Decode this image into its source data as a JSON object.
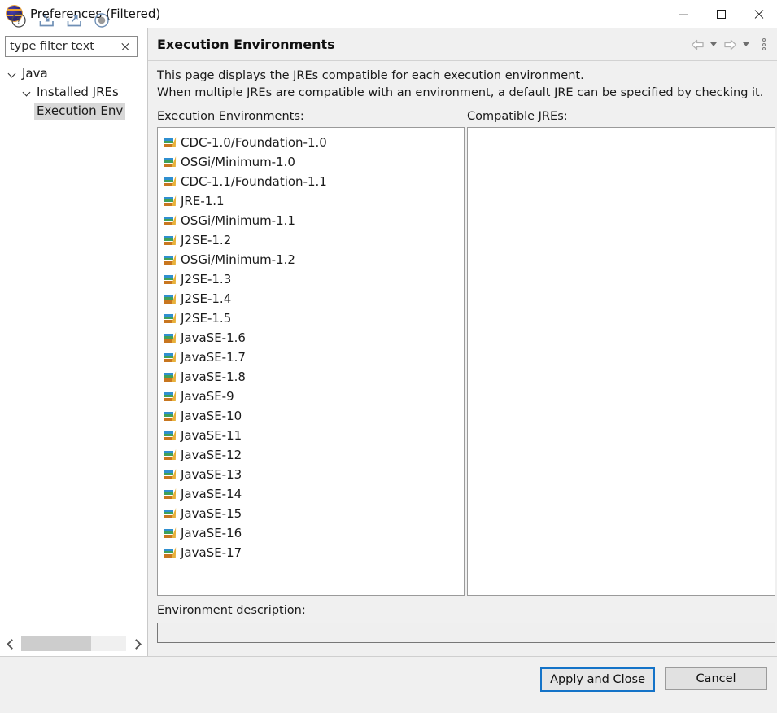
{
  "window": {
    "title": "Preferences (Filtered)",
    "icon": "eclipse-icon",
    "controls": {
      "minimize": "minimize-icon",
      "maximize": "maximize-icon",
      "close": "close-icon"
    }
  },
  "sidebar": {
    "filter": {
      "value": "type filter text",
      "placeholder": "type filter text",
      "clear_icon": "clear-icon"
    },
    "tree": [
      {
        "label": "Java",
        "level": 1,
        "expanded": true,
        "selected": false
      },
      {
        "label": "Installed JREs",
        "level": 2,
        "expanded": true,
        "selected": false
      },
      {
        "label": "Execution Env",
        "level": 3,
        "expanded": null,
        "selected": true
      }
    ],
    "scrollbar": {
      "left_icon": "chevron-left-icon",
      "right_icon": "chevron-right-icon"
    }
  },
  "content": {
    "page_title": "Execution Environments",
    "toolbar": {
      "back_icon": "arrow-left-icon",
      "back_menu_icon": "chevron-down-icon",
      "forward_icon": "arrow-right-icon",
      "forward_menu_icon": "chevron-down-icon",
      "overflow_icon": "vertical-dots-icon"
    },
    "description_line1": "This page displays the JREs compatible for each execution environment.",
    "description_line2": "When multiple JREs are compatible with an environment, a default JRE can be specified by checking it.",
    "environments_label": "Execution Environments:",
    "compatible_label": "Compatible JREs:",
    "environments": [
      "CDC-1.0/Foundation-1.0",
      "OSGi/Minimum-1.0",
      "CDC-1.1/Foundation-1.1",
      "JRE-1.1",
      "OSGi/Minimum-1.1",
      "J2SE-1.2",
      "OSGi/Minimum-1.2",
      "J2SE-1.3",
      "J2SE-1.4",
      "J2SE-1.5",
      "JavaSE-1.6",
      "JavaSE-1.7",
      "JavaSE-1.8",
      "JavaSE-9",
      "JavaSE-10",
      "JavaSE-11",
      "JavaSE-12",
      "JavaSE-13",
      "JavaSE-14",
      "JavaSE-15",
      "JavaSE-16",
      "JavaSE-17"
    ],
    "compatible_jres": [],
    "env_description_label": "Environment description:",
    "env_description_value": ""
  },
  "footer": {
    "icons": [
      "help-icon",
      "import-icon",
      "export-icon",
      "restore-defaults-icon"
    ],
    "apply_and_close_label": "Apply and Close",
    "cancel_label": "Cancel"
  },
  "colors": {
    "accent": "#1473c8",
    "titlebar_bg": "#ffffff",
    "panel_bg": "#f0f0f0",
    "list_bg": "#ffffff",
    "selection_bg": "#d8d8d8",
    "icon_blue": "#2f8fd0",
    "icon_green": "#3fa05a",
    "icon_orange": "#c8761f",
    "icon_yellow": "#e8b13b",
    "footer_icon_blue": "#6f8fb5"
  }
}
